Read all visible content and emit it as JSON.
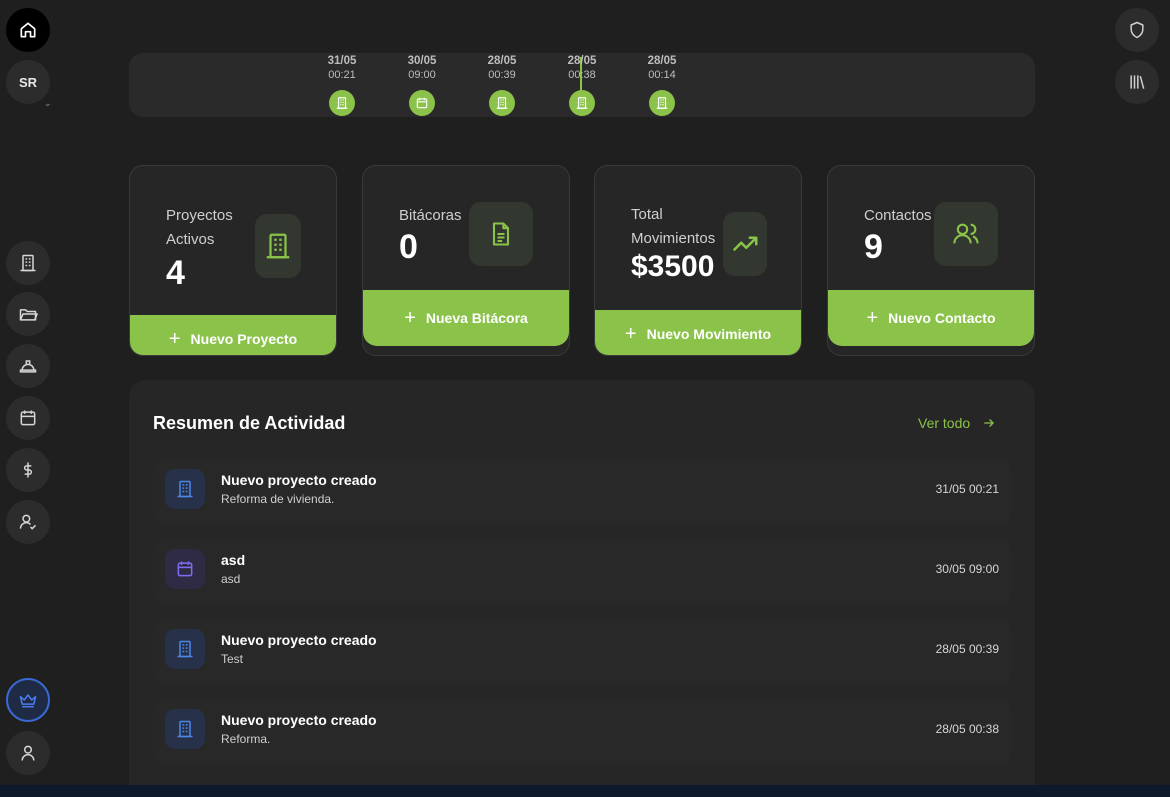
{
  "user": {
    "initials": "SR"
  },
  "colors": {
    "accent": "#8bc34a",
    "background": "#1f1f1f",
    "card": "#262626",
    "blue_icon": "#4a86e8",
    "purple_icon": "#7c6ff0"
  },
  "left_nav": {
    "top": [
      "home-icon",
      "avatar"
    ],
    "items": [
      "building-icon",
      "folder-icon",
      "hard-hat-icon",
      "calendar-icon",
      "dollar-icon",
      "user-check-icon"
    ],
    "bottom": [
      "crown-icon",
      "user-icon"
    ]
  },
  "right_nav": [
    "shield-icon",
    "library-icon"
  ],
  "timeline": [
    {
      "date": "31/05",
      "time": "00:21",
      "icon": "building-icon"
    },
    {
      "date": "30/05",
      "time": "09:00",
      "icon": "calendar-icon"
    },
    {
      "date": "28/05",
      "time": "00:39",
      "icon": "building-icon"
    },
    {
      "date": "28/05",
      "time": "00:38",
      "icon": "building-icon"
    },
    {
      "date": "28/05",
      "time": "00:14",
      "icon": "building-icon"
    }
  ],
  "stats": [
    {
      "label_line1": "Proyectos",
      "label_line2": "Activos",
      "value": "4",
      "icon": "building-icon",
      "action": "Nuevo Proyecto"
    },
    {
      "label_line1": "Bitácoras",
      "value": "0",
      "icon": "document-icon",
      "action": "Nueva Bitácora"
    },
    {
      "label_line1": "Total",
      "label_line2": "Movimientos",
      "value": "$3500",
      "icon": "trending-up-icon",
      "action": "Nuevo Movimiento"
    },
    {
      "label_line1": "Contactos",
      "value": "9",
      "icon": "users-icon",
      "action": "Nuevo Contacto"
    }
  ],
  "activity": {
    "title": "Resumen de Actividad",
    "view_all": "Ver todo",
    "items": [
      {
        "title": "Nuevo proyecto creado",
        "subtitle": "Reforma de vivienda.",
        "time": "31/05 00:21",
        "icon": "building-icon"
      },
      {
        "title": "asd",
        "subtitle": "asd",
        "time": "30/05 09:00",
        "icon": "calendar-icon"
      },
      {
        "title": "Nuevo proyecto creado",
        "subtitle": "Test",
        "time": "28/05 00:39",
        "icon": "building-icon"
      },
      {
        "title": "Nuevo proyecto creado",
        "subtitle": "Reforma.",
        "time": "28/05 00:38",
        "icon": "building-icon"
      }
    ]
  }
}
